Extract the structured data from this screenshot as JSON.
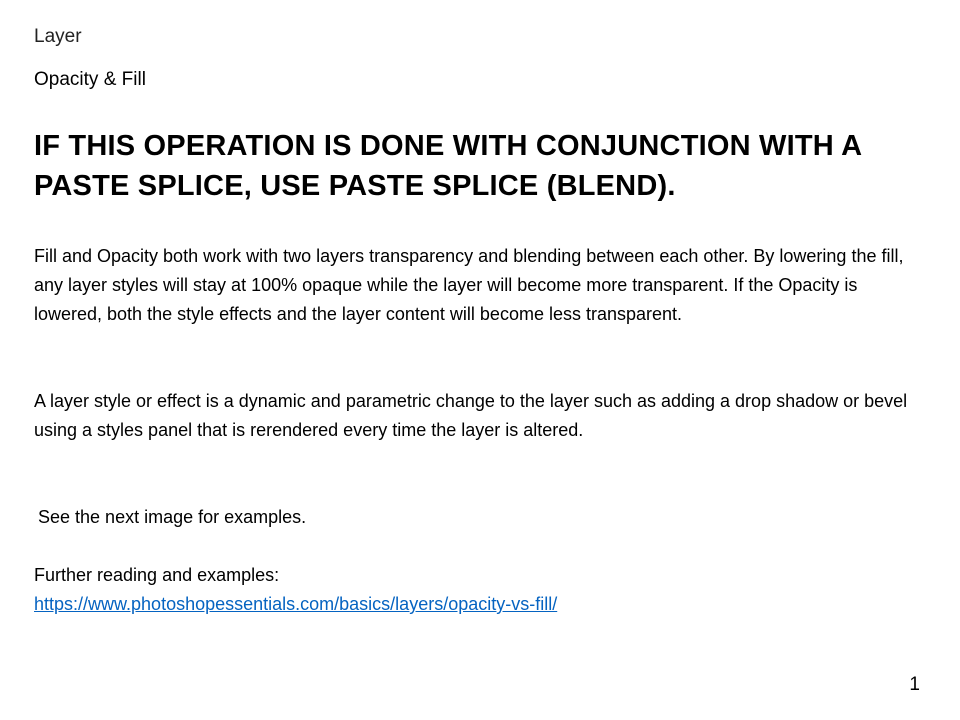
{
  "slide": {
    "section_label": "Layer",
    "subsection_label": "Opacity & Fill",
    "heading": "IF THIS OPERATION IS DONE WITH CONJUNCTION WITH A PASTE SPLICE, USE PASTE SPLICE (BLEND).",
    "paragraph_1": "Fill and Opacity both work with two layers transparency and blending between each other. By lowering the fill, any layer styles will stay at 100% opaque while the layer will become more transparent. If the Opacity is lowered, both the style effects and the layer content will become less transparent.",
    "paragraph_2": "A layer style or effect is a dynamic and parametric change to the layer such as adding a drop shadow or bevel using a styles panel that is rerendered every time the layer is altered.",
    "paragraph_3": "See the next image for examples.",
    "further_reading_label": "Further reading and examples:",
    "link_text": "https://www.photoshopessentials.com/basics/layers/opacity-vs-fill/",
    "page_number": "1"
  },
  "colors": {
    "link": "#0563c1",
    "text": "#000000",
    "background": "#ffffff"
  }
}
